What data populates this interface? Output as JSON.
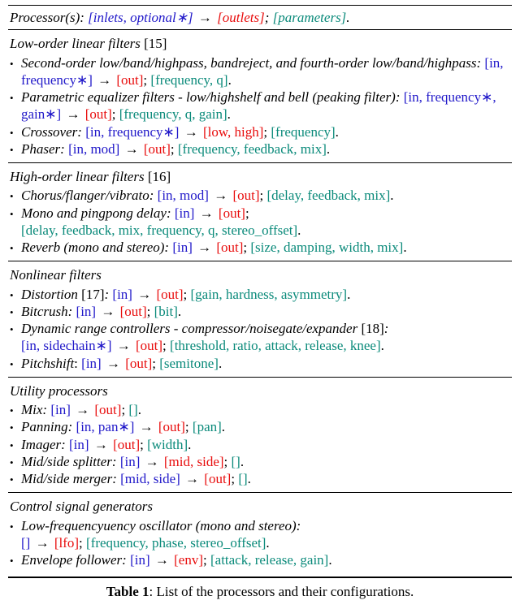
{
  "header": {
    "label": "Processor(s): ",
    "inlets": "[inlets, optional∗]",
    "outlets": "[outlets]",
    "params": "[parameters]"
  },
  "sections": [
    {
      "title": "Low-order linear filters",
      "ref": " [15]",
      "items": [
        {
          "name": "Second-order low/band/highpass, bandreject, and fourth-order low/band/highpass:",
          "inlets": "[in, frequency∗]",
          "outlets": "[out]",
          "params": "[frequency, q]"
        },
        {
          "name": "Parametric equalizer filters - low/highshelf and bell (peaking filter):",
          "inlets": "[in, frequency∗, gain∗]",
          "outlets": "[out]",
          "params": "[frequency, q, gain]"
        },
        {
          "name": "Crossover:",
          "inlets": "[in, frequency∗]",
          "outlets": "[low, high]",
          "params": "[frequency]"
        },
        {
          "name": "Phaser:",
          "inlets": "[in, mod]",
          "outlets": "[out]",
          "params": "[frequency, feedback, mix]"
        }
      ]
    },
    {
      "title": "High-order linear filters",
      "ref": " [16]",
      "items": [
        {
          "name": "Chorus/flanger/vibrato:",
          "inlets": "[in, mod]",
          "outlets": "[out]",
          "params": "[delay, feedback, mix]"
        },
        {
          "name": "Mono and pingpong delay:",
          "inlets": "[in]",
          "outlets": "[out]",
          "params": "[delay, feedback, mix, frequency, q, stereo_offset]",
          "break_before_params": true
        },
        {
          "name": "Reverb (mono and stereo):",
          "inlets": "[in]",
          "outlets": "[out]",
          "params": "[size, damping, width, mix]"
        }
      ]
    },
    {
      "title": "Nonlinear filters",
      "ref": "",
      "items": [
        {
          "name": "Distortion",
          "ref": " [17]",
          "colon": ": ",
          "inlets": "[in]",
          "outlets": "[out]",
          "params": "[gain, hardness, asymmetry]"
        },
        {
          "name": "Bitcrush:",
          "inlets": "[in]",
          "outlets": "[out]",
          "params": "[bit]"
        },
        {
          "name": "Dynamic range controllers - compressor/noisegate/expander",
          "ref": " [18]",
          "colon": ":",
          "inlets": "[in, sidechain∗]",
          "outlets": "[out]",
          "params": "[threshold, ratio, attack, release, knee]",
          "break_before_inlets": true
        },
        {
          "name": "Pitchshift",
          "name_tail_plain": ": ",
          "inlets": "[in]",
          "outlets": "[out]",
          "params": "[semitone]"
        }
      ]
    },
    {
      "title": "Utility processors",
      "ref": "",
      "items": [
        {
          "name": "Mix:",
          "inlets": "[in]",
          "outlets": "[out]",
          "params": "[]"
        },
        {
          "name": "Panning:",
          "inlets": "[in, pan∗]",
          "outlets": "[out]",
          "params": "[pan]"
        },
        {
          "name": "Imager:",
          "inlets": "[in]",
          "outlets": "[out]",
          "params": "[width]"
        },
        {
          "name": "Mid/side splitter:",
          "inlets": "[in]",
          "outlets": "[mid, side]",
          "params": "[]"
        },
        {
          "name": "Mid/side merger:",
          "inlets": "[mid, side]",
          "outlets": "[out]",
          "params": "[]"
        }
      ]
    },
    {
      "title": "Control signal generators",
      "ref": "",
      "items": [
        {
          "name": "Low-frequencyuency oscillator (mono and stereo):",
          "inlets": "[]",
          "outlets": "[lfo]",
          "params": "[frequency, phase, stereo_offset]",
          "break_before_inlets": true
        },
        {
          "name": "Envelope follower:",
          "inlets": "[in]",
          "outlets": "[env]",
          "params": "[attack, release, gain]"
        }
      ]
    }
  ],
  "caption": {
    "label": "Table 1",
    "text": ": List of the processors and their configurations."
  }
}
